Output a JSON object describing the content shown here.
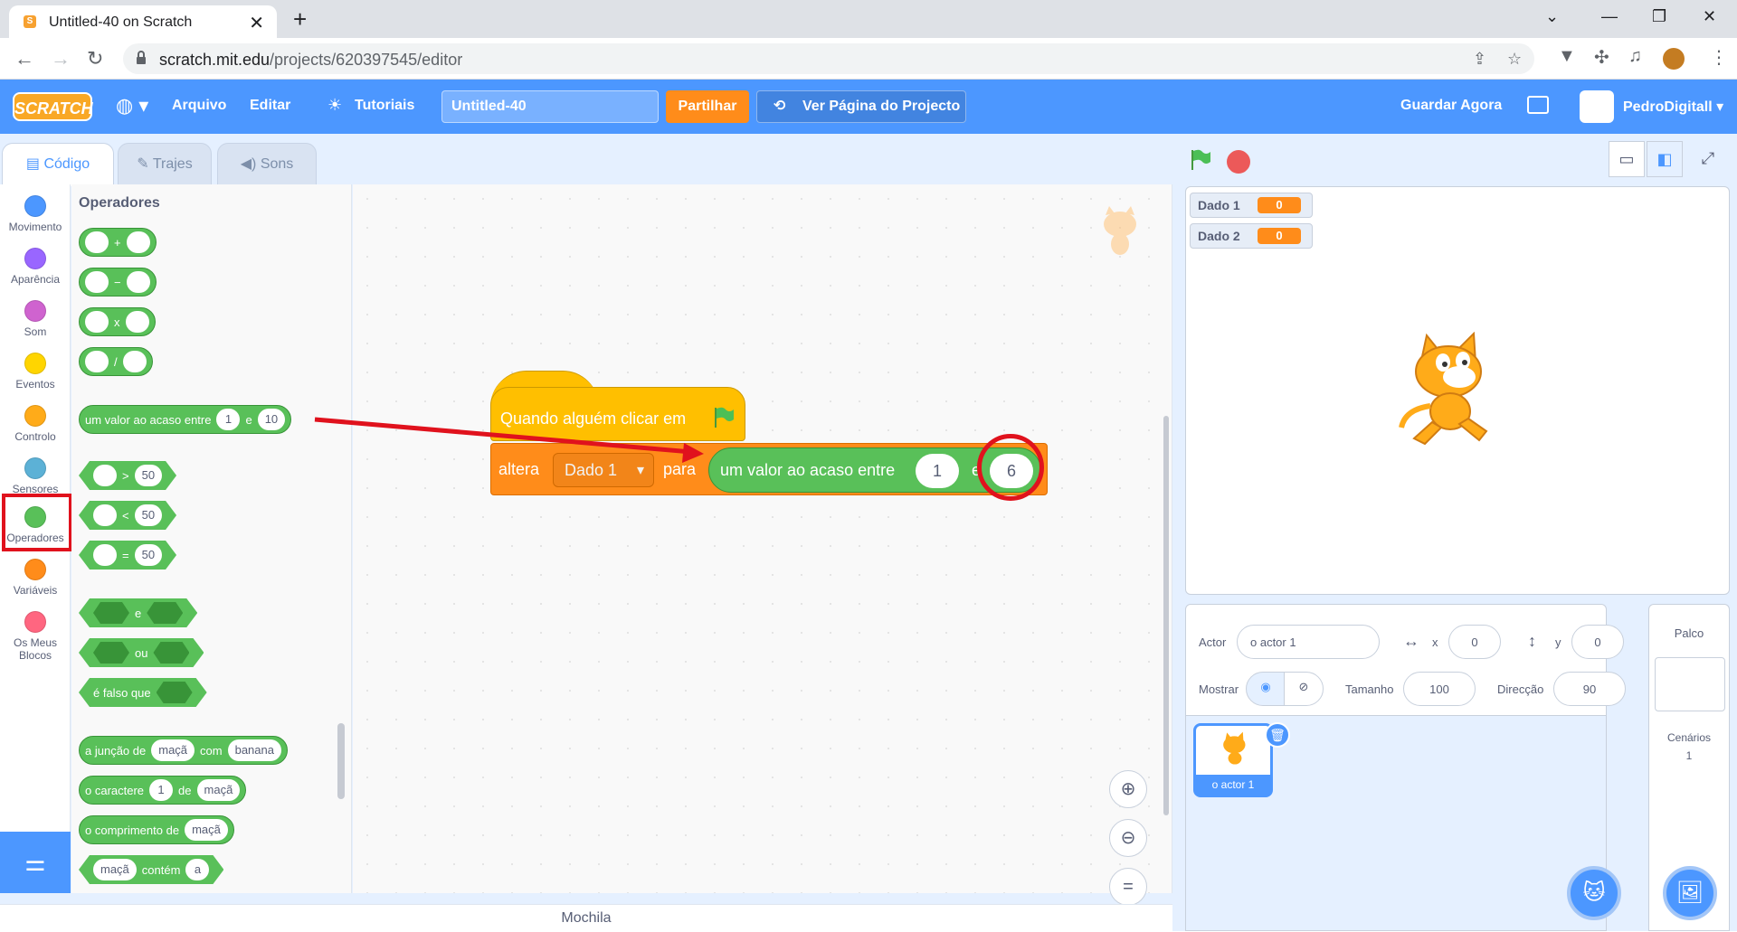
{
  "browser": {
    "tab_title": "Untitled-40 on Scratch",
    "tab_close": "✕",
    "new_tab": "+",
    "url_host": "scratch.mit.edu",
    "url_path": "/projects/620397545/editor",
    "window_minimize": "⌄",
    "window_min": "—",
    "window_max": "❐",
    "window_close": "✕"
  },
  "menubar": {
    "logo": "SCRATCH",
    "file": "Arquivo",
    "edit": "Editar",
    "tutorials": "Tutoriais",
    "project_title": "Untitled-40",
    "share": "Partilhar",
    "see_project": "Ver Página do Projecto",
    "save_now": "Guardar Agora",
    "username": "PedroDigitall"
  },
  "editor_tabs": {
    "code": "Código",
    "costumes": "Trajes",
    "sounds": "Sons"
  },
  "categories": [
    {
      "label": "Movimento",
      "color": "#4c97ff"
    },
    {
      "label": "Aparência",
      "color": "#9966ff"
    },
    {
      "label": "Som",
      "color": "#cf63cf"
    },
    {
      "label": "Eventos",
      "color": "#ffd500"
    },
    {
      "label": "Controlo",
      "color": "#ffab19"
    },
    {
      "label": "Sensores",
      "color": "#5cb1d6"
    },
    {
      "label": "Operadores",
      "color": "#59c059"
    },
    {
      "label": "Variáveis",
      "color": "#ff8c1a"
    },
    {
      "label": "Os Meus",
      "color": "#ff6680"
    }
  ],
  "category_mymyblocks_line2": "Blocos",
  "palette": {
    "title": "Operadores",
    "op_add": "+",
    "op_sub": "−",
    "op_mul": "x",
    "op_div": "/",
    "random_label": "um valor ao acaso entre",
    "random_from": "1",
    "random_and": "e",
    "random_to": "10",
    "gt": ">",
    "lt": "<",
    "eq": "=",
    "cmp_value": "50",
    "and": "e",
    "or": "ou",
    "not": "é falso que",
    "join_label": "a junção de",
    "join_a": "maçã",
    "join_with": "com",
    "join_b": "banana",
    "letter_label": "o caractere",
    "letter_n": "1",
    "letter_of": "de",
    "letter_word": "maçã",
    "length_label": "o comprimento de",
    "length_word": "maçã",
    "contains_word": "maçã",
    "contains_label": "contém",
    "contains_char": "a"
  },
  "script": {
    "hat_label": "Quando alguém clicar em",
    "set_label": "altera",
    "variable": "Dado 1",
    "to_label": "para",
    "random_label": "um valor ao acaso entre",
    "from": "1",
    "and": "e",
    "to": "6"
  },
  "backpack": "Mochila",
  "stage": {
    "monitors": [
      {
        "name": "Dado 1",
        "value": "0"
      },
      {
        "name": "Dado 2",
        "value": "0"
      }
    ]
  },
  "sprite_info": {
    "actor_label": "Actor",
    "actor_name": "o actor 1",
    "x_label": "x",
    "x": "0",
    "y_label": "y",
    "y": "0",
    "show_label": "Mostrar",
    "size_label": "Tamanho",
    "size": "100",
    "direction_label": "Direcção",
    "direction": "90"
  },
  "sprite_tile": "o actor 1",
  "stage_panel": {
    "title": "Palco",
    "backdrops_label": "Cenários",
    "backdrops_count": "1"
  },
  "accent": "#4c97ff",
  "highlight": "#e0121d"
}
